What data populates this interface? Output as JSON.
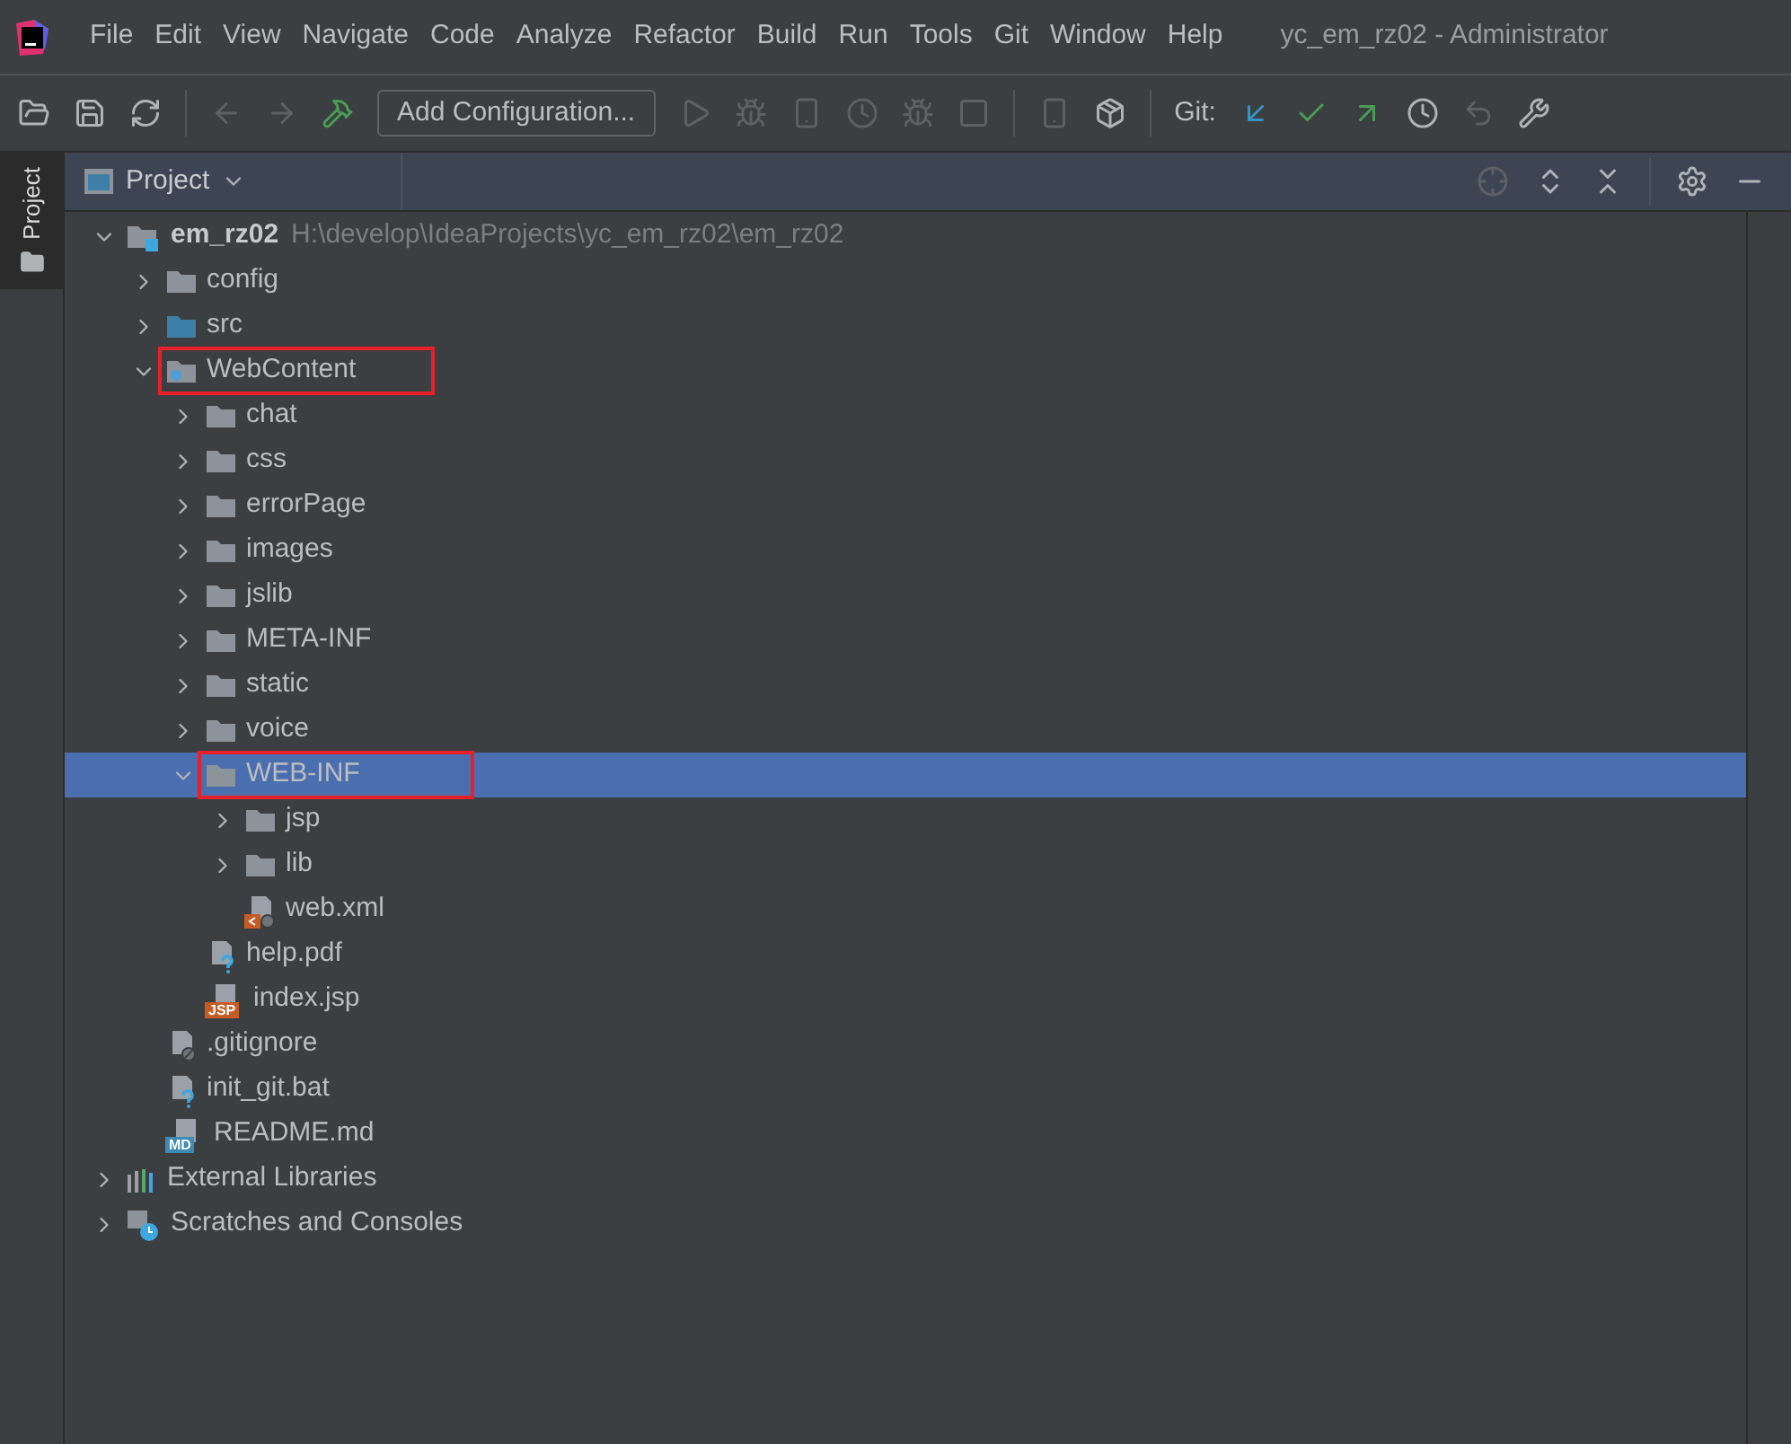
{
  "menu": [
    "File",
    "Edit",
    "View",
    "Navigate",
    "Code",
    "Analyze",
    "Refactor",
    "Build",
    "Run",
    "Tools",
    "Git",
    "Window",
    "Help"
  ],
  "window": {
    "title": "yc_em_rz02 - Administrator"
  },
  "toolbar": {
    "run_config": "Add Configuration...",
    "git_label": "Git:"
  },
  "side_tab": {
    "label": "Project",
    "selected": true
  },
  "panel": {
    "title": "Project"
  },
  "tree": [
    {
      "name": "em_rz02",
      "path": "H:\\develop\\IdeaProjects\\yc_em_rz02\\em_rz02",
      "kind": "module",
      "expanded": true,
      "selected": false,
      "highlighted": false,
      "children": [
        {
          "name": "config",
          "kind": "folder",
          "expanded": false,
          "selected": false,
          "highlighted": false
        },
        {
          "name": "src",
          "kind": "source-folder",
          "expanded": false,
          "selected": false,
          "highlighted": false
        },
        {
          "name": "WebContent",
          "kind": "web-folder",
          "expanded": true,
          "selected": false,
          "highlighted": true,
          "children": [
            {
              "name": "chat",
              "kind": "folder",
              "expanded": false,
              "selected": false,
              "highlighted": false
            },
            {
              "name": "css",
              "kind": "folder",
              "expanded": false,
              "selected": false,
              "highlighted": false
            },
            {
              "name": "errorPage",
              "kind": "folder",
              "expanded": false,
              "selected": false,
              "highlighted": false
            },
            {
              "name": "images",
              "kind": "folder",
              "expanded": false,
              "selected": false,
              "highlighted": false
            },
            {
              "name": "jslib",
              "kind": "folder",
              "expanded": false,
              "selected": false,
              "highlighted": false
            },
            {
              "name": "META-INF",
              "kind": "folder",
              "expanded": false,
              "selected": false,
              "highlighted": false
            },
            {
              "name": "static",
              "kind": "folder",
              "expanded": false,
              "selected": false,
              "highlighted": false
            },
            {
              "name": "voice",
              "kind": "folder",
              "expanded": false,
              "selected": false,
              "highlighted": false
            },
            {
              "name": "WEB-INF",
              "kind": "folder",
              "expanded": true,
              "selected": true,
              "highlighted": true,
              "children": [
                {
                  "name": "jsp",
                  "kind": "folder",
                  "expanded": false,
                  "selected": false,
                  "highlighted": false
                },
                {
                  "name": "lib",
                  "kind": "folder",
                  "expanded": false,
                  "selected": false,
                  "highlighted": false
                },
                {
                  "name": "web.xml",
                  "kind": "xml-file",
                  "selected": false,
                  "highlighted": false
                }
              ]
            },
            {
              "name": "help.pdf",
              "kind": "unknown-file",
              "selected": false,
              "highlighted": false
            },
            {
              "name": "index.jsp",
              "kind": "jsp-file",
              "badge": "JSP",
              "selected": false,
              "highlighted": false
            }
          ]
        },
        {
          "name": ".gitignore",
          "kind": "ignore-file",
          "selected": false,
          "highlighted": false
        },
        {
          "name": "init_git.bat",
          "kind": "unknown-file",
          "selected": false,
          "highlighted": false
        },
        {
          "name": "README.md",
          "kind": "md-file",
          "badge": "MD",
          "selected": false,
          "highlighted": false
        }
      ]
    },
    {
      "name": "External Libraries",
      "kind": "libraries",
      "expanded": false,
      "selected": false,
      "highlighted": false
    },
    {
      "name": "Scratches and Consoles",
      "kind": "scratches",
      "expanded": false,
      "selected": false,
      "highlighted": false
    }
  ]
}
